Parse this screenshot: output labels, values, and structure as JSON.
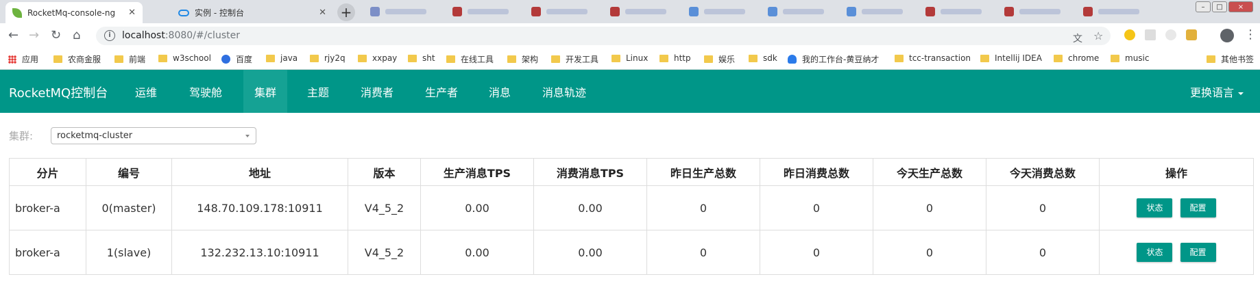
{
  "browser": {
    "tabs": [
      {
        "title": "RocketMq-console-ng",
        "icon": "leaf-icon",
        "active": true
      },
      {
        "title": "实例 - 控制台",
        "icon": "cloud-icon",
        "active": false
      }
    ],
    "new_tab_label": "+",
    "window_controls": [
      "–",
      "□",
      "×"
    ],
    "nav": {
      "back": "←",
      "forward": "→",
      "reload": "↻",
      "home": "⌂"
    },
    "url_host": "localhost",
    "url_rest": ":8080/#/cluster",
    "omnibox_icons": {
      "translate": "文",
      "star": "☆"
    },
    "menu": "⋮"
  },
  "bookmarks": [
    {
      "label": "应用",
      "icon": "apps-icon"
    },
    {
      "label": "农商金服",
      "icon": "folder-icon"
    },
    {
      "label": "前端",
      "icon": "folder-icon"
    },
    {
      "label": "w3school",
      "icon": "folder-icon"
    },
    {
      "label": "百度",
      "icon": "baidu-icon"
    },
    {
      "label": "java",
      "icon": "folder-icon"
    },
    {
      "label": "rjy2q",
      "icon": "folder-icon"
    },
    {
      "label": "xxpay",
      "icon": "folder-icon"
    },
    {
      "label": "sht",
      "icon": "folder-icon"
    },
    {
      "label": "在线工具",
      "icon": "folder-icon"
    },
    {
      "label": "架构",
      "icon": "folder-icon"
    },
    {
      "label": "开发工具",
      "icon": "folder-icon"
    },
    {
      "label": "Linux",
      "icon": "folder-icon"
    },
    {
      "label": "http",
      "icon": "folder-icon"
    },
    {
      "label": "娱乐",
      "icon": "folder-icon"
    },
    {
      "label": "sdk",
      "icon": "folder-icon"
    },
    {
      "label": "我的工作台-黄豆纳才",
      "icon": "person-icon"
    },
    {
      "label": "tcc-transaction",
      "icon": "folder-icon"
    },
    {
      "label": "Intellij IDEA",
      "icon": "folder-icon"
    },
    {
      "label": "chrome",
      "icon": "folder-icon"
    },
    {
      "label": "music",
      "icon": "folder-icon"
    },
    {
      "label": "其他书签",
      "icon": "folder-icon"
    }
  ],
  "app": {
    "brand": "RocketMQ控制台",
    "nav": [
      "运维",
      "驾驶舱",
      "集群",
      "主题",
      "消费者",
      "生产者",
      "消息",
      "消息轨迹"
    ],
    "active_nav": "集群",
    "language": "更换语言",
    "accent": "#009688"
  },
  "cluster": {
    "label": "集群:",
    "selected": "rocketmq-cluster"
  },
  "table": {
    "headers": [
      "分片",
      "编号",
      "地址",
      "版本",
      "生产消息TPS",
      "消费消息TPS",
      "昨日生产总数",
      "昨日消费总数",
      "今天生产总数",
      "今天消费总数",
      "操作"
    ],
    "rows": [
      [
        "broker-a",
        "0(master)",
        "148.70.109.178:10911",
        "V4_5_2",
        "0.00",
        "0.00",
        "0",
        "0",
        "0",
        "0"
      ],
      [
        "broker-a",
        "1(slave)",
        "132.232.13.10:10911",
        "V4_5_2",
        "0.00",
        "0.00",
        "0",
        "0",
        "0",
        "0"
      ]
    ],
    "actions": {
      "status": "状态",
      "config": "配置"
    }
  }
}
